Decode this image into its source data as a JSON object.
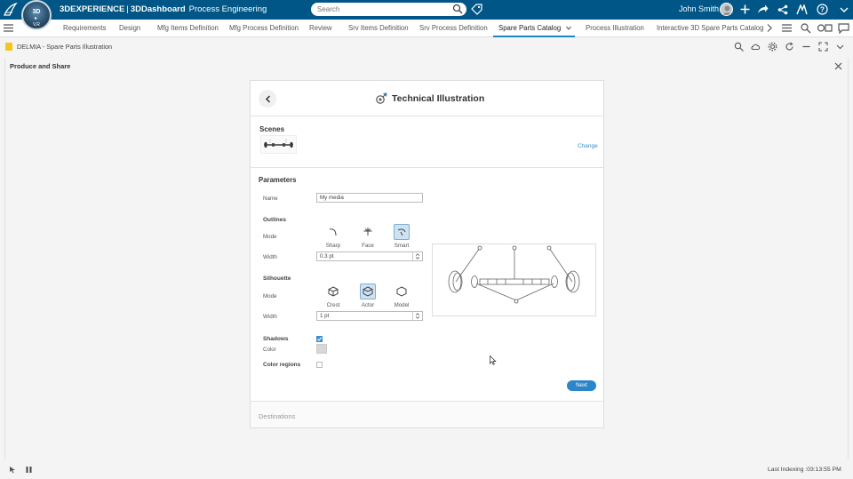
{
  "topbar": {
    "brand_bold": "3DEXPERIENCE",
    "brand_sep": "|",
    "brand_dash": "3DDashboard",
    "app_name": "Process Engineering",
    "search_placeholder": "Search",
    "user_name": "John Smith",
    "compass": {
      "top": "3D",
      "mid": "V.R",
      "bot": "V,R"
    }
  },
  "tabs": {
    "items": [
      {
        "label": "Requirements"
      },
      {
        "label": "Design"
      },
      {
        "label": "Mfg Items Definition"
      },
      {
        "label": "Mfg Process Definition"
      },
      {
        "label": "Review"
      },
      {
        "label": "Srv Items Definition"
      },
      {
        "label": "Srv Process Definition"
      },
      {
        "label": "Spare Parts Catalog",
        "active": true
      },
      {
        "label": "Process Illustration"
      },
      {
        "label": "Interactive 3D Spare Parts Catalog"
      }
    ]
  },
  "widget": {
    "title": "DELMIA - Spare Parts Illustration"
  },
  "panel": {
    "title": "Produce and Share"
  },
  "card": {
    "title": "Technical Illustration",
    "scenes_label": "Scenes",
    "change_label": "Change",
    "parameters_label": "Parameters",
    "name_label": "Name",
    "name_value": "My media",
    "outlines_label": "Outlines",
    "outline_mode_label": "Mode",
    "outline_modes": [
      {
        "label": "Sharp",
        "icon": "sharp-icon"
      },
      {
        "label": "Face",
        "icon": "face-icon"
      },
      {
        "label": "Smart",
        "icon": "smart-icon",
        "selected": true
      }
    ],
    "outline_width_label": "Width",
    "outline_width_value": "0.3 pt",
    "silhouette_label": "Silhouette",
    "silhouette_mode_label": "Mode",
    "silhouette_modes": [
      {
        "label": "Crest",
        "icon": "crest-icon"
      },
      {
        "label": "Actor",
        "icon": "actor-icon",
        "selected": true
      },
      {
        "label": "Model",
        "icon": "model-icon"
      }
    ],
    "silhouette_width_label": "Width",
    "silhouette_width_value": "1 pt",
    "shadows_label": "Shadows",
    "shadows_checked": true,
    "color_label": "Color",
    "color_value": "#d7d7d7",
    "color_regions_label": "Color regions",
    "color_regions_checked": false,
    "next_label": "Next",
    "destinations_label": "Destinations"
  },
  "status": {
    "last_indexing": "Last Indexing :03:13:55 PM"
  },
  "colors": {
    "topbar": "#005686",
    "accent": "#2b86c9",
    "selected_bg": "#cfe2f2"
  }
}
